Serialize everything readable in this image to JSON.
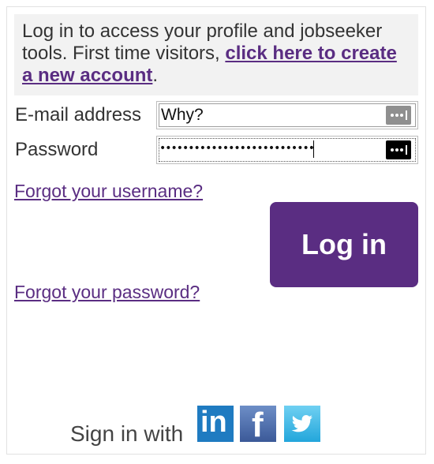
{
  "intro": {
    "text": "Log in to access your profile and jobseeker tools. First time visitors, ",
    "link": "click here to create a new account",
    "after": "."
  },
  "form": {
    "email_label": "E-mail address",
    "email_value": "Why?",
    "password_label": "Password",
    "password_value": "•••••••••••••••••••••••••••"
  },
  "links": {
    "forgot_username": "Forgot your username?",
    "forgot_password": "Forgot your password?"
  },
  "login_button": "Log in",
  "social": {
    "label": "Sign in with",
    "linkedin": "in",
    "facebook": "f",
    "twitter_icon": "twitter-bird"
  },
  "colors": {
    "accent": "#5a2d82",
    "linkedin": "#1f7bc1",
    "facebook": "#3b5998",
    "twitter": "#23a6db"
  }
}
